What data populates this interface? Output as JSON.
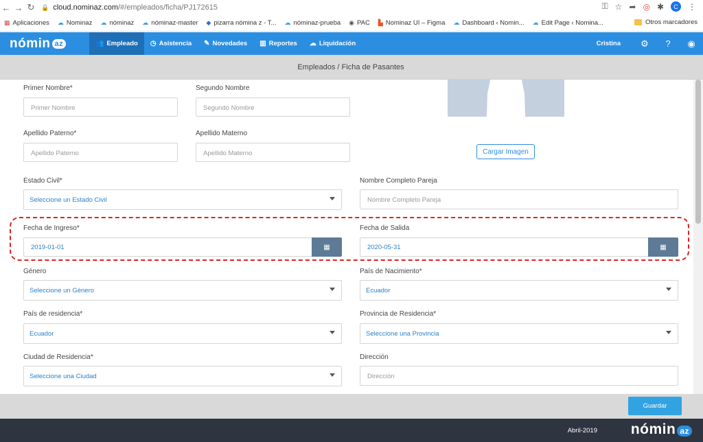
{
  "browser": {
    "url_host": "cloud.nominaz.com",
    "url_path": "/#/empleados/ficha/PJ172615",
    "profile_initial": "C"
  },
  "bookmarks": {
    "items": [
      {
        "icon": "apps-grid-icon",
        "label": "Aplicaciones"
      },
      {
        "icon": "cloud-icon",
        "label": "Nominaz"
      },
      {
        "icon": "cloud-icon",
        "label": "nóminaz"
      },
      {
        "icon": "cloud-icon",
        "label": "nóminaz-master"
      },
      {
        "icon": "diamond-icon",
        "label": "pizarra nómina z - T..."
      },
      {
        "icon": "cloud-icon",
        "label": "nóminaz-prueba"
      },
      {
        "icon": "globe-icon",
        "label": "PAC"
      },
      {
        "icon": "figma-icon",
        "label": "Nominaz UI – Figma"
      },
      {
        "icon": "cloud-icon",
        "label": "Dashboard ‹ Nomin..."
      },
      {
        "icon": "cloud-icon",
        "label": "Edit Page ‹ Nomina..."
      }
    ],
    "other": "Otros marcadores"
  },
  "navbar": {
    "logo_text": "nómin",
    "logo_badge": "az",
    "items": [
      {
        "icon": "users-icon",
        "label": "Empleado",
        "active": true
      },
      {
        "icon": "clock-icon",
        "label": "Asistencia"
      },
      {
        "icon": "edit-icon",
        "label": "Novedades"
      },
      {
        "icon": "bar-chart-icon",
        "label": "Reportes"
      },
      {
        "icon": "cloud-upload-icon",
        "label": "Liquidación"
      }
    ],
    "user": "Cristina"
  },
  "breadcrumb": "Empleados / Ficha de Pasantes",
  "form": {
    "primer_nombre": {
      "label": "Primer Nombre*",
      "placeholder": "Primer Nombre"
    },
    "segundo_nombre": {
      "label": "Segundo Nombre",
      "placeholder": "Segundo Nombre"
    },
    "apellido_paterno": {
      "label": "Apellido Paterno*",
      "placeholder": "Apellido Paterno"
    },
    "apellido_materno": {
      "label": "Apellido Materno",
      "placeholder": "Apellido Materno"
    },
    "cargar_imagen": "Cargar Imagen",
    "estado_civil": {
      "label": "Estado Civil*",
      "value": "Seleccione un Estado Civil"
    },
    "nombre_pareja": {
      "label": "Nombre Completo Pareja",
      "placeholder": "Nombre Completo Pareja"
    },
    "fecha_ingreso": {
      "label": "Fecha de Ingreso*",
      "value": "2019-01-01"
    },
    "fecha_salida": {
      "label": "Fecha de Salida",
      "value": "2020-05-31"
    },
    "genero": {
      "label": "Género",
      "value": "Seleccione un Género"
    },
    "pais_nacimiento": {
      "label": "País de Nacimiento*",
      "value": "Ecuador"
    },
    "pais_residencia": {
      "label": "País de residencia*",
      "value": "Ecuador"
    },
    "provincia_residencia": {
      "label": "Provincia de Residencia*",
      "value": "Seleccione una Provincia"
    },
    "ciudad_residencia": {
      "label": "Ciudad de Residencia*",
      "value": "Seleccione una Ciudad"
    },
    "direccion": {
      "label": "Dirección",
      "placeholder": "Dirección"
    }
  },
  "actions": {
    "save": "Guardar"
  },
  "footer": {
    "date": "Abril-2019",
    "logo_text": "nómin",
    "logo_badge": "az"
  },
  "colors": {
    "primary": "#2c8ee0",
    "active_nav": "#1f6fb6",
    "footer": "#2e3440",
    "highlight": "#e02020"
  }
}
